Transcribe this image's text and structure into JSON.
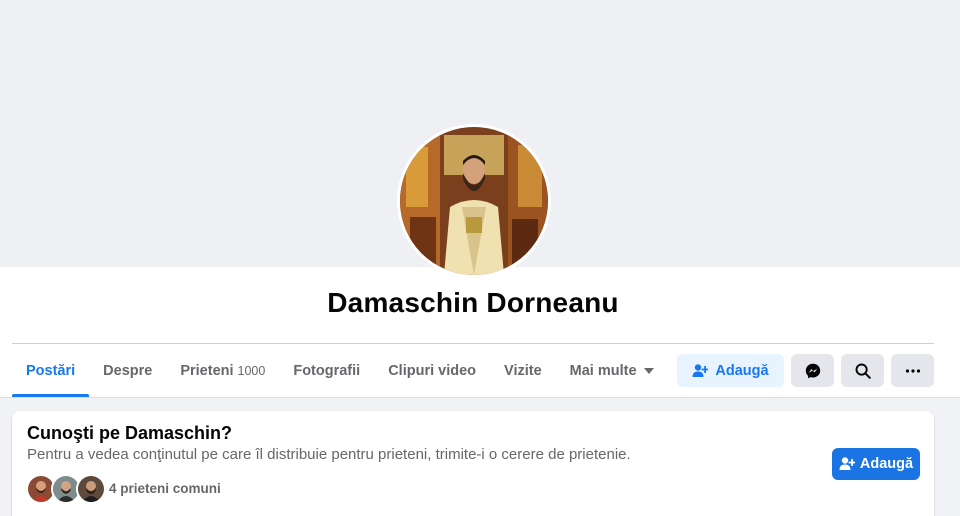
{
  "profile": {
    "name": "Damaschin Dorneanu"
  },
  "tabs": [
    {
      "label": "Postări",
      "count": "",
      "active": true
    },
    {
      "label": "Despre",
      "count": ""
    },
    {
      "label": "Prieteni",
      "count": "1000"
    },
    {
      "label": "Fotografii",
      "count": ""
    },
    {
      "label": "Clipuri video",
      "count": ""
    },
    {
      "label": "Vizite",
      "count": ""
    },
    {
      "label": "Mai multe",
      "count": ""
    }
  ],
  "actions": {
    "add_friend_label": "Adaugă"
  },
  "card": {
    "title": "Cunoşti pe Damaschin?",
    "subtitle": "Pentru a vedea conţinutul pe care îl distribuie pentru prieteni, trimite-i o cerere de prietenie.",
    "mutual_friends": "4 prieteni comuni",
    "add_button_label": "Adaugă"
  },
  "colors": {
    "accent": "#1877f2",
    "accent_light": "#e7f3ff",
    "button_grey": "#e4e6eb",
    "page_bg": "#f0f2f5",
    "secondary_text": "#65676b"
  },
  "icons": [
    "add-friend-icon",
    "messenger-icon",
    "search-icon",
    "more-icon",
    "caret-down-icon"
  ]
}
